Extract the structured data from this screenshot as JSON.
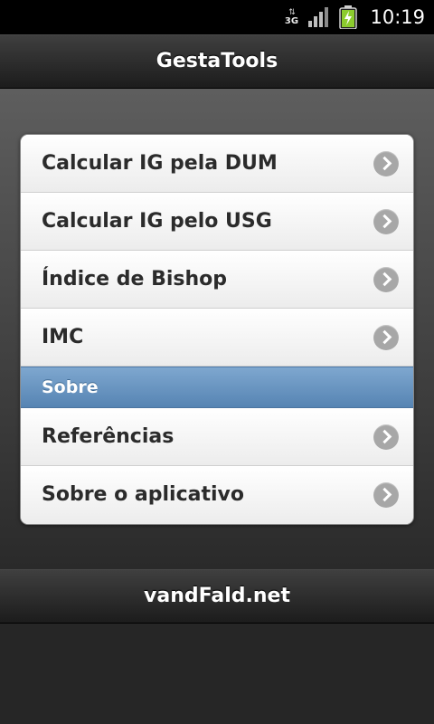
{
  "status_bar": {
    "network_label": "3G",
    "network_arrows": "⇅",
    "signal_icon": "signal-bars-icon",
    "battery_icon": "battery-charging-icon",
    "time": "10:19"
  },
  "header": {
    "title": "GestaTools"
  },
  "menu": {
    "items": [
      {
        "label": "Calcular IG pela DUM",
        "icon": "chevron-right-icon"
      },
      {
        "label": "Calcular IG pelo USG",
        "icon": "chevron-right-icon"
      },
      {
        "label": "Índice de Bishop",
        "icon": "chevron-right-icon"
      },
      {
        "label": "IMC",
        "icon": "chevron-right-icon"
      }
    ],
    "divider": {
      "label": "Sobre"
    },
    "about_items": [
      {
        "label": "Referências",
        "icon": "chevron-right-icon"
      },
      {
        "label": "Sobre o aplicativo",
        "icon": "chevron-right-icon"
      }
    ]
  },
  "footer": {
    "text": "vandFald.net"
  },
  "colors": {
    "divider_blue": "#6b97c3",
    "battery_green": "#8ccc2e",
    "arrow_gray": "#a7a7a7"
  }
}
